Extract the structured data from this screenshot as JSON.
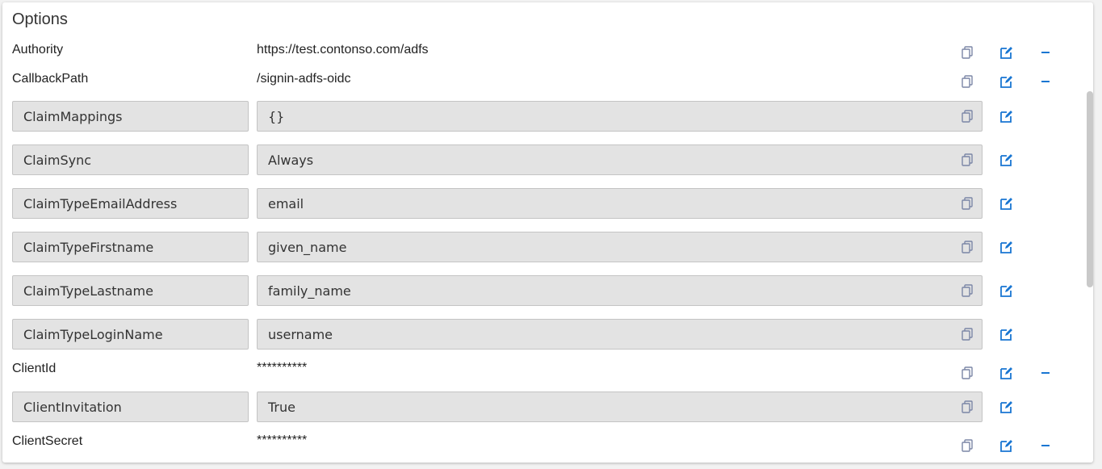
{
  "header": {
    "title": "Options"
  },
  "rows": [
    {
      "name": "Authority",
      "value": "https://test.contonso.com/adfs"
    },
    {
      "name": "CallbackPath",
      "value": "/signin-adfs-oidc"
    },
    {
      "name": "ClaimMappings",
      "value": "{}"
    },
    {
      "name": "ClaimSync",
      "value": "Always"
    },
    {
      "name": "ClaimTypeEmailAddress",
      "value": "email"
    },
    {
      "name": "ClaimTypeFirstname",
      "value": "given_name"
    },
    {
      "name": "ClaimTypeLastname",
      "value": "family_name"
    },
    {
      "name": "ClaimTypeLoginName",
      "value": "username"
    },
    {
      "name": "ClientId",
      "value": "**********"
    },
    {
      "name": "ClientInvitation",
      "value": "True"
    },
    {
      "name": "ClientSecret",
      "value": "**********"
    }
  ],
  "icons": {
    "copy": "copy-icon",
    "edit": "edit-icon",
    "remove": "minus-icon"
  },
  "colors": {
    "icon_blue": "#1976d2",
    "copy_gray": "#7b86a6",
    "field_bg": "#e3e3e3"
  }
}
